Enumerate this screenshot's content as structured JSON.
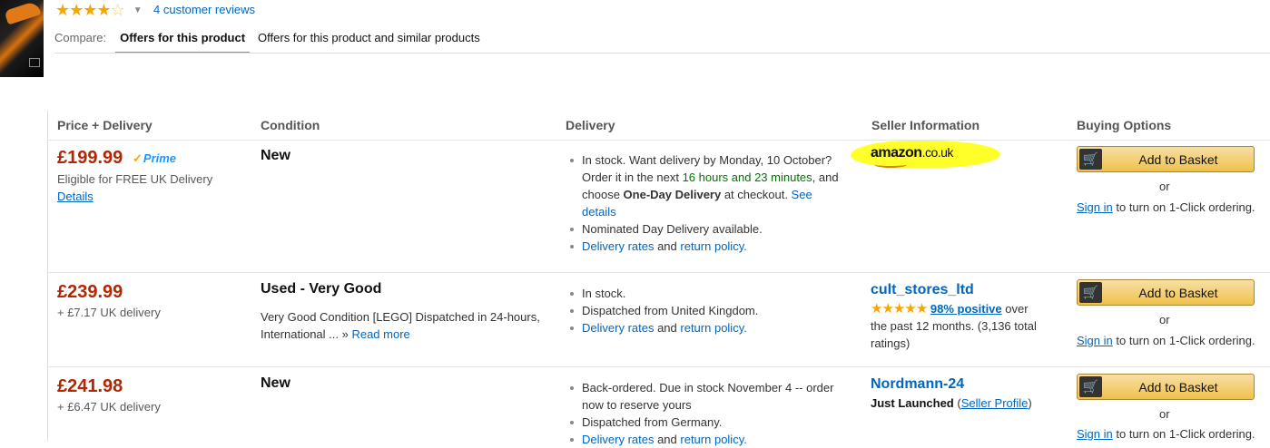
{
  "header": {
    "reviews_link": "4 customer reviews",
    "rating_stars": 4.5,
    "compare_label": "Compare:",
    "tabs": [
      {
        "label": "Offers for this product",
        "active": true
      },
      {
        "label": "Offers for this product and similar products",
        "active": false
      }
    ]
  },
  "columns": [
    "Price + Delivery",
    "Condition",
    "Delivery",
    "Seller Information",
    "Buying Options"
  ],
  "offers": [
    {
      "price": "£199.99",
      "prime_label": "Prime",
      "delivery_note": "Eligible for FREE UK Delivery",
      "details_link": "Details",
      "condition": "New",
      "delivery": {
        "l1": "In stock. Want delivery by Monday, 10 October?",
        "l2a": "Order it in the next ",
        "l2b": "16 hours and 23 minutes",
        "l2c": ", and",
        "l3a": "choose ",
        "l3b": "One-Day Delivery",
        "l3c": " at checkout. ",
        "l3d": "See",
        "l4": "details",
        "b2": "Nominated Day Delivery available.",
        "rates": "Delivery rates",
        "and": " and ",
        "policy": "return policy."
      },
      "seller_logo_main": "amazon",
      "seller_logo_sub": ".co.uk",
      "add_label": "Add to Basket",
      "or": "or",
      "signin_link": "Sign in",
      "signin_rest": " to turn on 1-Click ordering."
    },
    {
      "price": "£239.99",
      "delivery_note": "+ £7.17 UK delivery",
      "condition": "Used - Very Good",
      "condition_desc1": "Very Good Condition [LEGO] Dispatched in 24-hours,",
      "condition_desc2": "International ... » ",
      "read_more": "Read more",
      "delivery": {
        "b1": "In stock.",
        "b2": "Dispatched from United Kingdom.",
        "rates": "Delivery rates",
        "and": " and ",
        "policy": "return policy."
      },
      "seller_name": "cult_stores_ltd",
      "seller_stars": 5,
      "positive_link": "98% positive",
      "rating_rest1": " over",
      "rating_rest2": "the past 12 months. (3,136 total",
      "rating_rest3": "ratings)",
      "add_label": "Add to Basket",
      "or": "or",
      "signin_link": "Sign in",
      "signin_rest": " to turn on 1-Click ordering."
    },
    {
      "price": "£241.98",
      "delivery_note": "+ £6.47 UK delivery",
      "condition": "New",
      "delivery": {
        "l1": "Back-ordered. Due in stock November 4 -- order",
        "l2": "now to reserve yours",
        "b2": "Dispatched from Germany.",
        "rates": "Delivery rates",
        "and": " and ",
        "policy": "return policy."
      },
      "seller_name": "Nordmann-24",
      "just_launched": "Just Launched",
      "seller_profile_open": " (",
      "seller_profile_link": "Seller Profile",
      "seller_profile_close": ")",
      "add_label": "Add to Basket",
      "or": "or",
      "signin_link": "Sign in",
      "signin_rest": " to turn on 1-Click ordering."
    }
  ]
}
